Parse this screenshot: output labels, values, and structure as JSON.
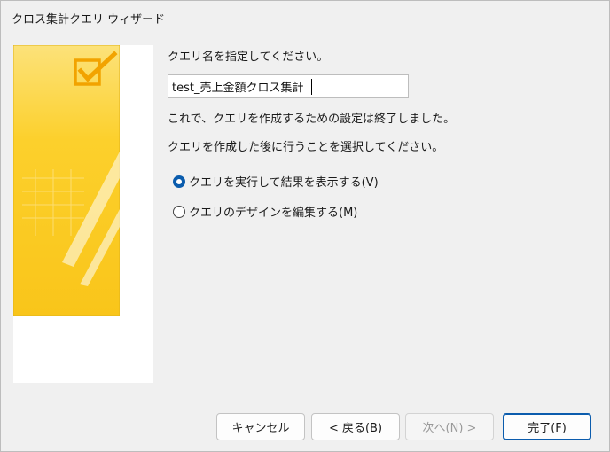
{
  "window": {
    "title": "クロス集計クエリ ウィザード"
  },
  "form": {
    "prompt": "クエリ名を指定してください。",
    "query_name": "test_売上金額クロス集計",
    "info_done": "これで、クエリを作成するための設定は終了しました。",
    "info_choose": "クエリを作成した後に行うことを選択してください。"
  },
  "options": {
    "selected": "run",
    "run_label": "クエリを実行して結果を表示する(V)",
    "design_label": "クエリのデザインを編集する(M)"
  },
  "buttons": {
    "cancel": "キャンセル",
    "back": "< 戻る(B)",
    "next": "次へ(N) >",
    "finish": "完了(F)"
  },
  "colors": {
    "accent": "#0b5cad",
    "illustration_yellow": "#fcd02c"
  },
  "icons": {
    "illustration": "checkbox-check-icon"
  }
}
